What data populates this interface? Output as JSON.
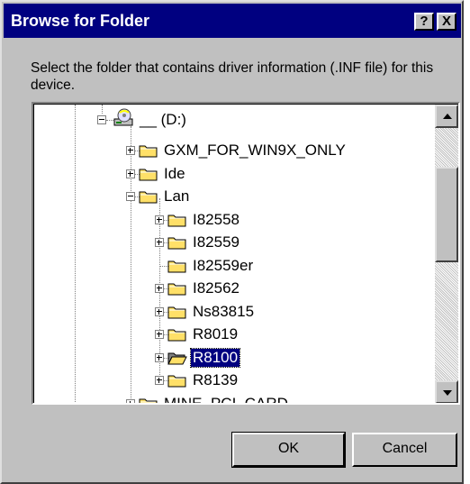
{
  "window": {
    "title": "Browse for Folder",
    "help_glyph": "?",
    "close_glyph": "X"
  },
  "prompt": "Select the folder that contains driver information (.INF file) for this device.",
  "tree": {
    "drive": "__ (D:)",
    "items": [
      {
        "label": "GXM_FOR_WIN9X_ONLY",
        "expander": "plus"
      },
      {
        "label": "Ide",
        "expander": "plus"
      },
      {
        "label": "Lan",
        "expander": "minus"
      },
      {
        "label": "I82558",
        "expander": "plus"
      },
      {
        "label": "I82559",
        "expander": "plus"
      },
      {
        "label": "I82559er",
        "expander": "none"
      },
      {
        "label": "I82562",
        "expander": "plus"
      },
      {
        "label": "Ns83815",
        "expander": "plus"
      },
      {
        "label": "R8019",
        "expander": "plus"
      },
      {
        "label": "R8100",
        "expander": "plus",
        "selected": true,
        "open_folder": true
      },
      {
        "label": "R8139",
        "expander": "plus"
      },
      {
        "label": "MINE_PCI_CARD",
        "expander": "plus"
      }
    ]
  },
  "buttons": {
    "ok": "OK",
    "cancel": "Cancel"
  },
  "colors": {
    "titlebar": "#000080",
    "dialog_face": "#c0c0c0",
    "folder": "#ffe068",
    "selection": "#000080"
  }
}
